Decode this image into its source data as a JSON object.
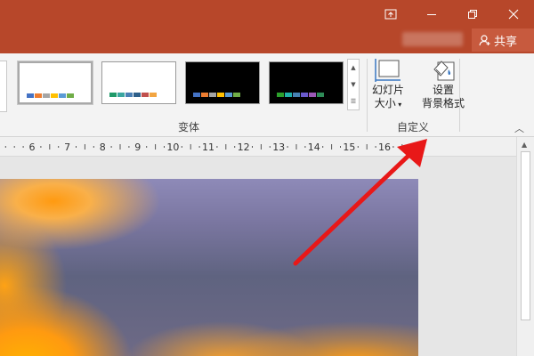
{
  "titlebar": {
    "share_label": "共享",
    "colors": {
      "background": "#b7472a",
      "share_bg": "#c75a3e"
    }
  },
  "ribbon": {
    "variants_group": {
      "label": "变体",
      "thumbnails": [
        {
          "theme": "light",
          "selected": true,
          "swatches": [
            "#4472c4",
            "#ed7d31",
            "#a5a5a5",
            "#ffc000",
            "#5b9bd5",
            "#70ad47"
          ]
        },
        {
          "theme": "light",
          "selected": false,
          "swatches": [
            "#1f9a69",
            "#3aa6a0",
            "#4a7fb5",
            "#2e5f8a",
            "#c0504d",
            "#f2a541"
          ]
        },
        {
          "theme": "dark",
          "selected": false,
          "swatches": [
            "#4472c4",
            "#ed7d31",
            "#a5a5a5",
            "#ffc000",
            "#5b9bd5",
            "#70ad47"
          ]
        },
        {
          "theme": "dark",
          "selected": false,
          "swatches": [
            "#2ca02c",
            "#20b2aa",
            "#4682b4",
            "#6a5acd",
            "#9b59b6",
            "#2e8b57"
          ]
        }
      ]
    },
    "customize_group": {
      "label": "自定义",
      "slide_size": {
        "line1": "幻灯片",
        "line2": "大小"
      },
      "format_background": {
        "line1": "设置",
        "line2": "背景格式"
      }
    }
  },
  "ruler": {
    "labels": [
      "6",
      "7",
      "8",
      "9",
      "10",
      "11",
      "12",
      "13",
      "14",
      "15",
      "16"
    ]
  },
  "annotation": {
    "arrow_color": "#e81818"
  }
}
